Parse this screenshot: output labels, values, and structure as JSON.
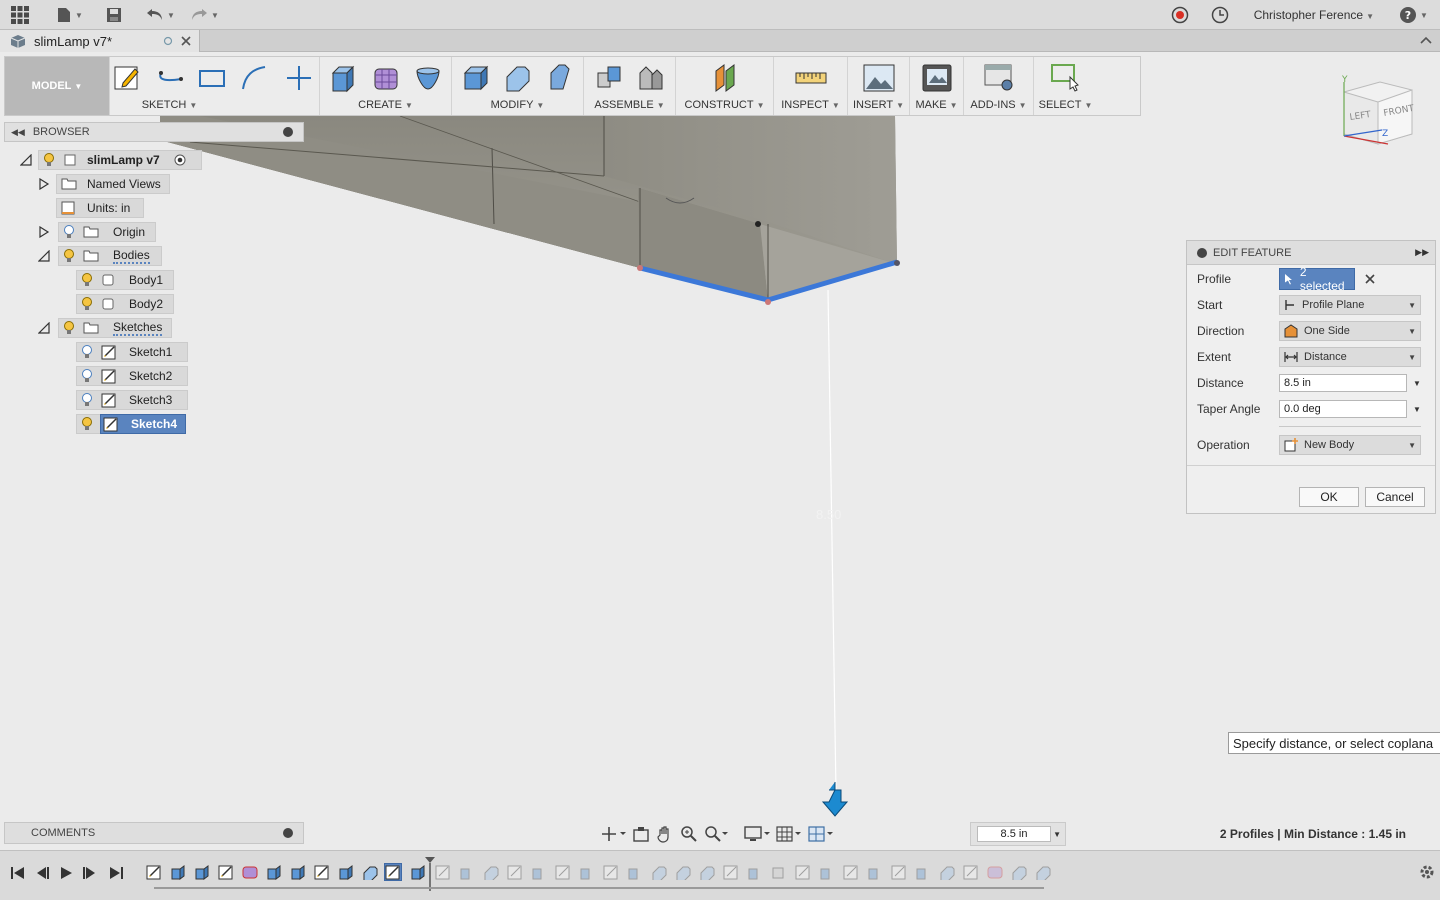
{
  "app": {
    "user_name": "Christopher Ference",
    "document_tab": "slimLamp v7*"
  },
  "toolbar": {
    "workspace": "MODEL",
    "groups": [
      "SKETCH",
      "CREATE",
      "MODIFY",
      "ASSEMBLE",
      "CONSTRUCT",
      "INSPECT",
      "INSERT",
      "MAKE",
      "ADD-INS",
      "SELECT"
    ]
  },
  "viewcube": {
    "left": "LEFT",
    "front": "FRONT",
    "axis_y": "Y",
    "axis_z": "Z"
  },
  "browser": {
    "title": "BROWSER",
    "items": [
      {
        "label": "slimLamp v7"
      },
      {
        "label": "Named Views"
      },
      {
        "label": "Units: in"
      },
      {
        "label": "Origin"
      },
      {
        "label": "Bodies"
      },
      {
        "label": "Body1"
      },
      {
        "label": "Body2"
      },
      {
        "label": "Sketches"
      },
      {
        "label": "Sketch1"
      },
      {
        "label": "Sketch2"
      },
      {
        "label": "Sketch3"
      },
      {
        "label": "Sketch4"
      }
    ]
  },
  "dialog": {
    "title": "EDIT FEATURE",
    "profile_label": "Profile",
    "profile_value": "2 selected",
    "start_label": "Start",
    "start_value": "Profile Plane",
    "direction_label": "Direction",
    "direction_value": "One Side",
    "extent_label": "Extent",
    "extent_value": "Distance",
    "distance_label": "Distance",
    "distance_value": "8.5 in",
    "taper_label": "Taper Angle",
    "taper_value": "0.0 deg",
    "operation_label": "Operation",
    "operation_value": "New Body",
    "ok": "OK",
    "cancel": "Cancel"
  },
  "canvas": {
    "dimension_text": "8.50"
  },
  "tooltip": "Specify distance, or select coplana",
  "comments": {
    "title": "COMMENTS"
  },
  "bottom": {
    "distance_input": "8.5 in",
    "status": "2 Profiles | Min Distance : 1.45 in"
  },
  "colors": {
    "selection_blue": "#3c78d8",
    "highlight_blue": "#5a84bf",
    "body_grey": "#7a786e"
  }
}
